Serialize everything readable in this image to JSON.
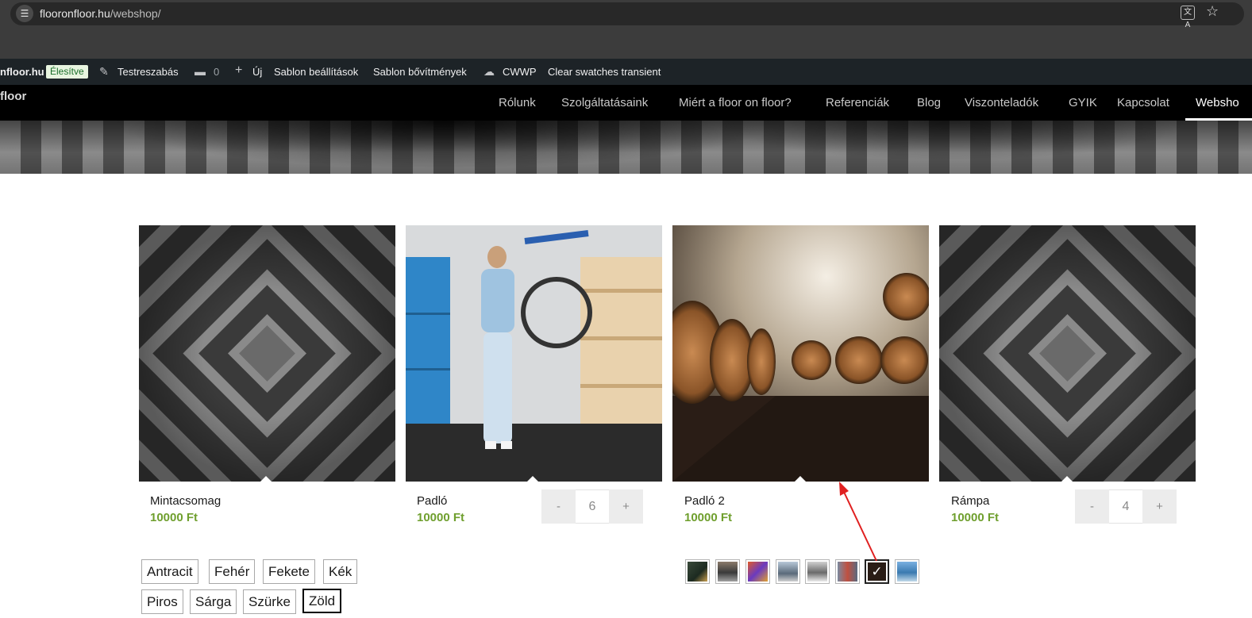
{
  "browser": {
    "url_domain": "flooronfloor.hu",
    "url_path": "/webshop/",
    "site_icon": "tune-icon",
    "translate_icon": "translate-icon",
    "bookmark_icon": "star-icon"
  },
  "admin_bar": {
    "site": "nfloor.hu",
    "status_badge": "Élesítve",
    "customize": "Testreszabás",
    "comments_count": "0",
    "new": "Új",
    "theme_settings": "Sablon beállítások",
    "theme_extensions": "Sablon bővítmények",
    "cwwp": "CWWP",
    "clear_swatches": "Clear swatches transient"
  },
  "site_nav": {
    "logo": "floor",
    "items": [
      {
        "label": "Rólunk"
      },
      {
        "label": "Szolgáltatásaink"
      },
      {
        "label": "Miért a floor on floor?"
      },
      {
        "label": "Referenciák"
      },
      {
        "label": "Blog"
      },
      {
        "label": "Viszonteladók"
      },
      {
        "label": "GYIK"
      },
      {
        "label": "Kapcsolat"
      },
      {
        "label": "Websho",
        "active": true
      }
    ]
  },
  "products": [
    {
      "name": "Mintacsomag",
      "price": "10000 Ft"
    },
    {
      "name": "Padló",
      "price": "10000 Ft",
      "quantity": "6"
    },
    {
      "name": "Padló 2",
      "price": "10000 Ft"
    },
    {
      "name": "Rámpa",
      "price": "10000 Ft",
      "quantity": "4"
    }
  ],
  "quantity_controls": {
    "minus": "-",
    "plus": "+"
  },
  "color_swatches": {
    "row1": [
      "Antracit",
      "Fehér",
      "Fekete",
      "Kék"
    ],
    "row2": [
      "Piros",
      "Sárga",
      "Szürke",
      "Zöld"
    ],
    "selected": "Zöld"
  },
  "image_swatches": {
    "count": 8,
    "selected_index": 6,
    "check_mark": "✓"
  },
  "colors": {
    "price_green": "#6f9f2e",
    "admin_bar_bg": "#1d2327",
    "nav_bg": "#000000",
    "annotation_arrow": "#e02020"
  }
}
